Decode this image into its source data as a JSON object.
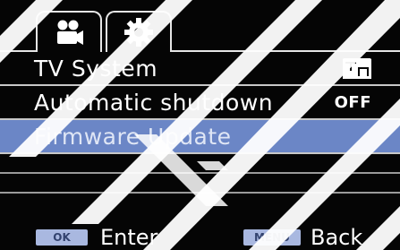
{
  "tabs": [
    {
      "icon": "video-camera-icon"
    },
    {
      "icon": "gear-icon",
      "active": true
    }
  ],
  "menu": {
    "items": [
      {
        "label": "TV System",
        "value_icon": "tv-format-icon"
      },
      {
        "label": "Automatic shutdown",
        "value": "OFF"
      },
      {
        "label": "Firmware Update",
        "selected": true
      }
    ],
    "empty_rows": 2
  },
  "footer": {
    "ok_key": "OK",
    "enter_label": "Enter",
    "menu_key": "MENU",
    "back_label": "Back"
  },
  "colors": {
    "background": "#050505",
    "selection": "#6b86c6",
    "key_badge": "#a9b8e0",
    "text": "#ffffff"
  }
}
